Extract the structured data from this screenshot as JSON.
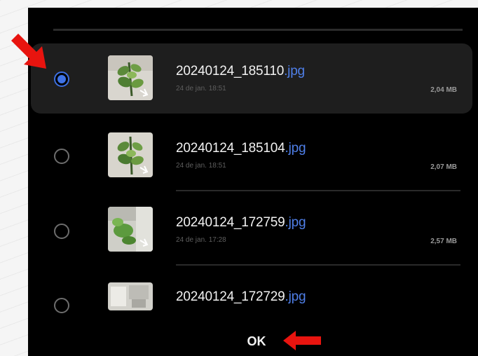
{
  "files": [
    {
      "name": "20240124_185110",
      "ext": ".jpg",
      "date": "24 de jan. 18:51",
      "size": "2,04 MB",
      "selected": true
    },
    {
      "name": "20240124_185104",
      "ext": ".jpg",
      "date": "24 de jan. 18:51",
      "size": "2,07 MB",
      "selected": false
    },
    {
      "name": "20240124_172759",
      "ext": ".jpg",
      "date": "24 de jan. 17:28",
      "size": "2,57 MB",
      "selected": false
    },
    {
      "name": "20240124_172729",
      "ext": ".jpg",
      "date": "",
      "size": "",
      "selected": false
    }
  ],
  "ok_label": "OK",
  "colors": {
    "accent": "#3f73e6",
    "background": "#000000",
    "annotation_arrow": "#e8140f"
  },
  "icons": {
    "radio_selected": "radio-checked-icon",
    "radio_unselected": "radio-unchecked-icon",
    "annotation": "red-arrow-icon"
  }
}
